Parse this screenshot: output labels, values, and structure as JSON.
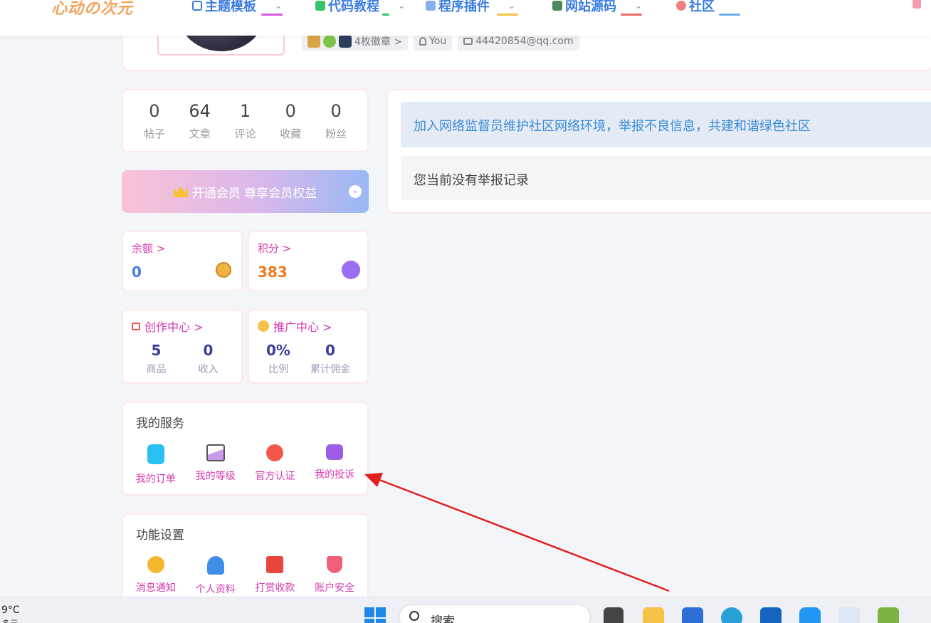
{
  "nav": {
    "logo": "心动の次元",
    "items": [
      {
        "label": "主题模板"
      },
      {
        "label": "代码教程"
      },
      {
        "label": "程序插件"
      },
      {
        "label": "网站源码"
      },
      {
        "label": "社区"
      }
    ]
  },
  "profile": {
    "badge_count": "4枚徽章 >",
    "username": "You",
    "email": "44420854@qq.com"
  },
  "stats": [
    {
      "value": "0",
      "label": "帖子"
    },
    {
      "value": "64",
      "label": "文章"
    },
    {
      "value": "1",
      "label": "评论"
    },
    {
      "value": "0",
      "label": "收藏"
    },
    {
      "value": "0",
      "label": "粉丝"
    }
  ],
  "vip": {
    "label": "开通会员 尊享会员权益"
  },
  "wallet": {
    "balance": {
      "title": "余额 >",
      "value": "0",
      "value_color": "#4a7be8"
    },
    "points": {
      "title": "积分 >",
      "value": "383",
      "value_color": "#f07a1e"
    }
  },
  "creator": {
    "title": "创作中心 >",
    "stats": [
      {
        "value": "5",
        "label": "商品"
      },
      {
        "value": "0",
        "label": "收入"
      }
    ]
  },
  "promo": {
    "title": "推广中心 >",
    "stats": [
      {
        "value": "0%",
        "label": "比例"
      },
      {
        "value": "0",
        "label": "累计佣金"
      }
    ]
  },
  "services": {
    "title": "我的服务",
    "items": [
      {
        "label": "我的订单",
        "icon": "clipboard-icon",
        "color": "#29c1f2"
      },
      {
        "label": "我的等级",
        "icon": "chart-icon",
        "color": "#b58ad8"
      },
      {
        "label": "官方认证",
        "icon": "verified-icon",
        "color": "#f2574a"
      },
      {
        "label": "我的投诉",
        "icon": "inbox-icon",
        "color": "#9b5de5"
      }
    ]
  },
  "settings": {
    "title": "功能设置",
    "items": [
      {
        "label": "消息通知",
        "icon": "chat-icon",
        "color": "#f5b72e"
      },
      {
        "label": "个人资料",
        "icon": "user-icon",
        "color": "#3e8ee8"
      },
      {
        "label": "打赏收款",
        "icon": "gift-icon",
        "color": "#e8453b"
      },
      {
        "label": "账户安全",
        "icon": "shield-icon",
        "color": "#f0607a"
      }
    ]
  },
  "panel": {
    "notice": "加入网络监督员维护社区网络环境，举报不良信息，共建和谐绿色社区",
    "empty": "您当前没有举报记录"
  },
  "taskbar": {
    "weather_temp": "9°C",
    "weather_desc": "多云",
    "search_label": "搜索"
  }
}
